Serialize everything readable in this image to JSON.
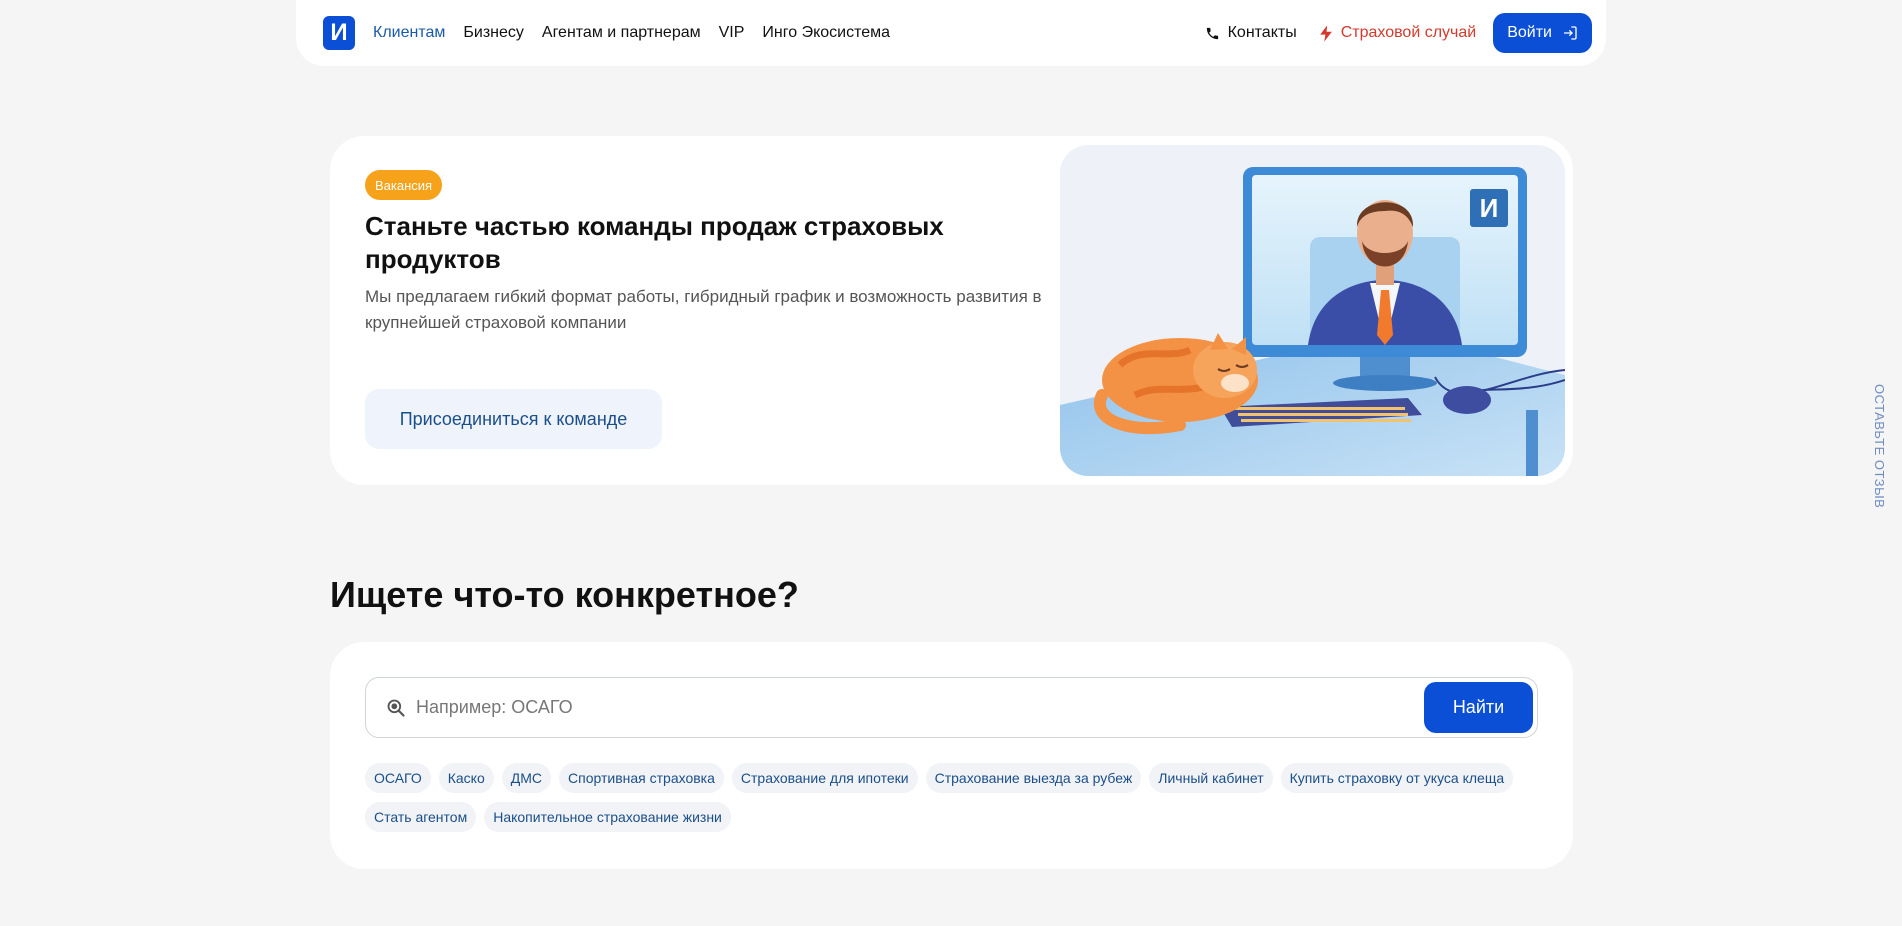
{
  "nav": {
    "logo_letter": "И",
    "links": [
      "Клиентам",
      "Бизнесу",
      "Агентам и партнерам",
      "VIP",
      "Инго Экосистема"
    ],
    "contacts": "Контакты",
    "claim": "Страховой случай",
    "login": "Войти"
  },
  "hero": {
    "badge": "Вакансия",
    "title": "Станьте частью команды продаж страховых продуктов",
    "subtitle": "Мы предлагаем гибкий формат работы, гибридный график и возможность развития в крупнейшей страховой компании",
    "button": "Присоединиться к команде",
    "screen_logo": "И"
  },
  "search": {
    "title": "Ищете что-то конкретное?",
    "placeholder": "Например: ОСАГО",
    "button": "Найти",
    "chips": [
      "ОСАГО",
      "Каско",
      "ДМС",
      "Спортивная страховка",
      "Страхование для ипотеки",
      "Страхование выезда за рубеж",
      "Личный кабинет",
      "Купить страховку от укуса клеща",
      "Стать агентом",
      "Накопительное страхование жизни"
    ]
  },
  "feedback": "ОСТАВЬТЕ ОТЗЫВ",
  "colors": {
    "primary": "#0b4fd6",
    "accent_link": "#1b5aa8",
    "claim": "#d33a2c",
    "badge": "#f6a21a",
    "background": "#f5f5f5"
  }
}
